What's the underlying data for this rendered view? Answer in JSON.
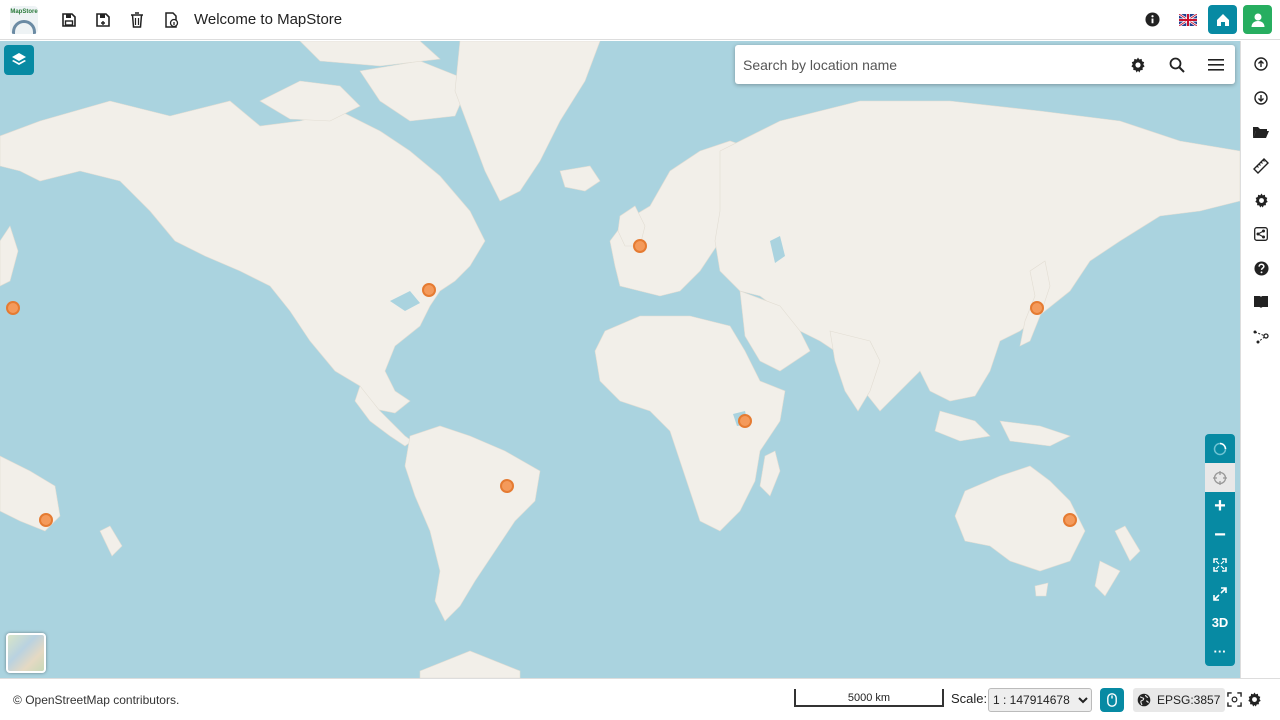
{
  "app": {
    "title": "Welcome to MapStore",
    "logo_text": "MapStore"
  },
  "toolbar": {
    "buttons": [
      "save-icon",
      "save-as-icon",
      "trash-icon",
      "map-details-icon"
    ],
    "right_buttons": [
      "info-icon",
      "language-flag-icon",
      "home-icon",
      "user-icon"
    ],
    "colors": {
      "accent": "#078aa3",
      "user": "#27ae60"
    }
  },
  "search": {
    "placeholder": "Search by location name",
    "icons": [
      "gear-icon",
      "search-icon",
      "burger-menu-icon"
    ]
  },
  "sidebar": {
    "items": [
      "upload-icon",
      "download-icon",
      "folder-open-icon",
      "ruler-icon",
      "gear-icon",
      "share-icon",
      "help-icon",
      "book-icon",
      "route-icon"
    ]
  },
  "map_controls": {
    "zoom_in": "+",
    "zoom_out": "−",
    "threed": "3D",
    "more": "···"
  },
  "markers": [
    {
      "name": "marker-honolulu",
      "color": "#f49a5b"
    },
    {
      "name": "marker-new-york",
      "color": "#f49a5b"
    },
    {
      "name": "marker-london",
      "color": "#f49a5b"
    },
    {
      "name": "marker-tokyo",
      "color": "#f49a5b"
    },
    {
      "name": "marker-nairobi",
      "color": "#f49a5b"
    },
    {
      "name": "marker-rio",
      "color": "#f49a5b"
    },
    {
      "name": "marker-melbourne",
      "color": "#f49a5b"
    },
    {
      "name": "marker-sydney",
      "color": "#f49a5b"
    }
  ],
  "footer": {
    "attribution_prefix": "©",
    "attribution_link": "OpenStreetMap",
    "attribution_suffix": "contributors.",
    "scalebar_label": "5000 km",
    "scale_label": "Scale:",
    "scale_value": "1 : 147914678",
    "crs": "EPSG:3857"
  }
}
